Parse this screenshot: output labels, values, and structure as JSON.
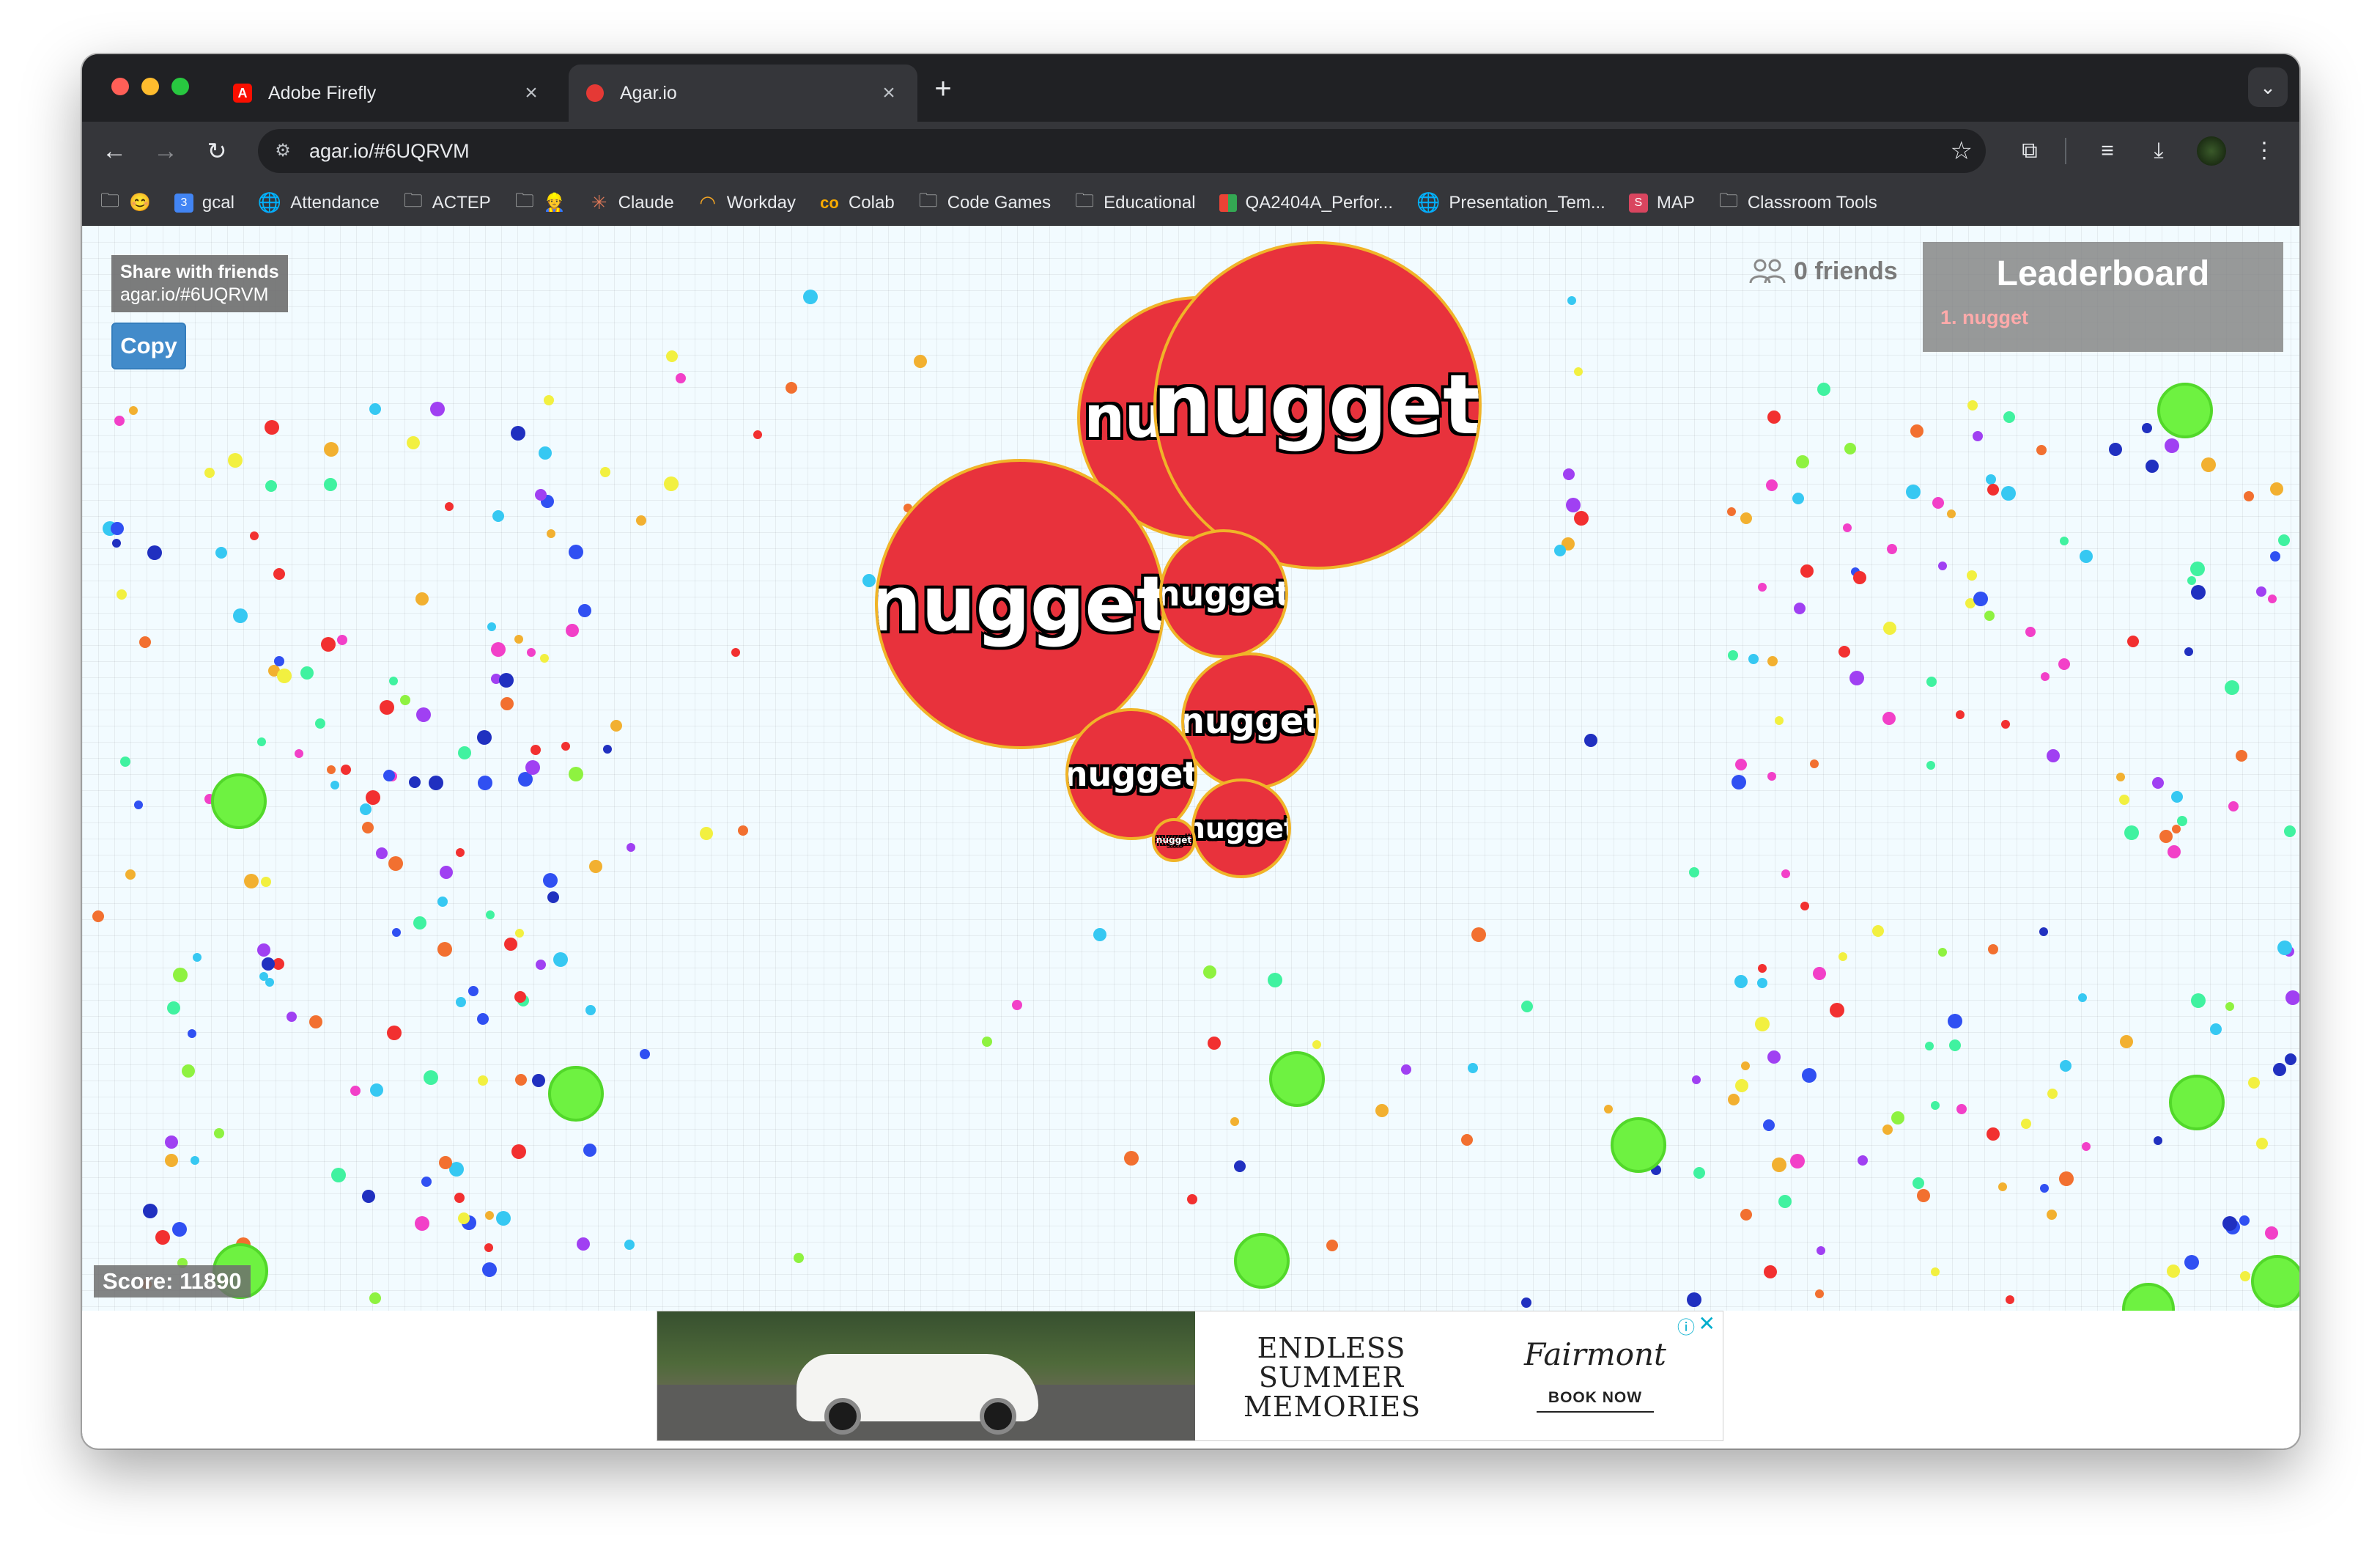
{
  "browser": {
    "tabs": [
      {
        "title": "Adobe Firefly",
        "icon": "adobe-icon",
        "active": false
      },
      {
        "title": "Agar.io",
        "icon": "agar-icon",
        "active": true
      }
    ],
    "new_tab": "+",
    "url": "agar.io/#6UQRVM",
    "bookmarks": [
      {
        "label": "",
        "icon": "folder-icon",
        "extra": "😊"
      },
      {
        "label": "gcal",
        "icon": "calendar-icon"
      },
      {
        "label": "Attendance",
        "icon": "globe-icon"
      },
      {
        "label": "ACTEP",
        "icon": "folder-icon"
      },
      {
        "label": "",
        "icon": "folder-icon",
        "extra": "👷"
      },
      {
        "label": "Claude",
        "icon": "claude-icon"
      },
      {
        "label": "Workday",
        "icon": "workday-icon"
      },
      {
        "label": "Colab",
        "icon": "colab-icon"
      },
      {
        "label": "Code Games",
        "icon": "folder-icon"
      },
      {
        "label": "Educational",
        "icon": "folder-icon"
      },
      {
        "label": "QA2404A_Perfor...",
        "icon": "sheets-icon"
      },
      {
        "label": "Presentation_Tem...",
        "icon": "globe-icon"
      },
      {
        "label": "MAP",
        "icon": "map-icon"
      },
      {
        "label": "Classroom Tools",
        "icon": "folder-icon"
      }
    ]
  },
  "game": {
    "share_title": "Share with friends",
    "share_link": "agar.io/#6UQRVM",
    "copy_label": "Copy",
    "friends_label": "0 friends",
    "leaderboard_title": "Leaderboard",
    "leaderboard": [
      "1. nugget"
    ],
    "score": "Score: 11890",
    "player_name": "nugget",
    "cell_color": "#e8323c",
    "cell_border_color": "#f0b428",
    "virus_color": "#6ef241"
  },
  "ad": {
    "headline": "ENDLESS SUMMER MEMORIES",
    "brand": "Fairmont",
    "cta": "BOOK NOW"
  }
}
